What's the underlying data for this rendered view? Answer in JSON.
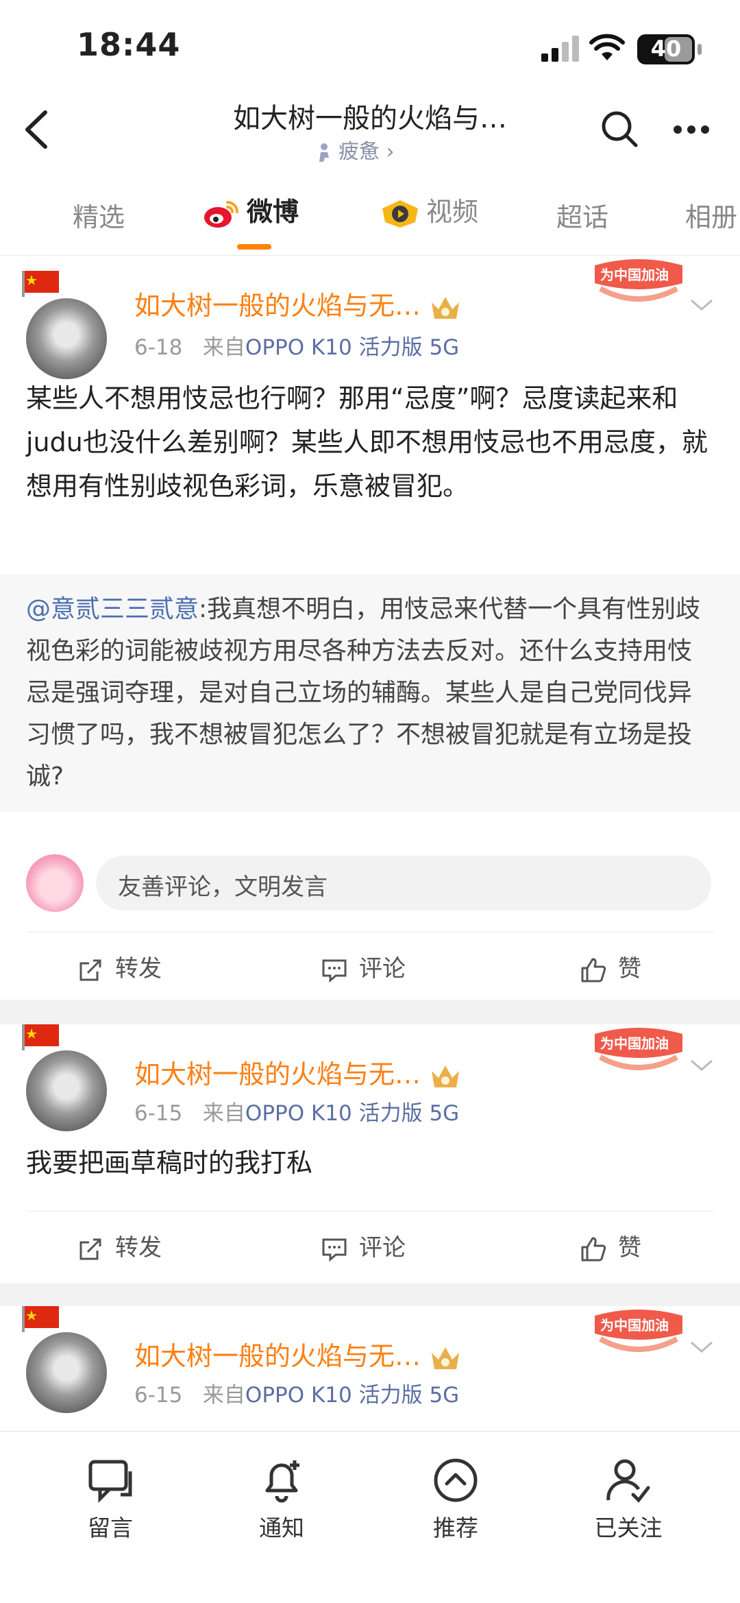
{
  "status_bar": {
    "time": "18:44",
    "battery": "40"
  },
  "header": {
    "title": "如大树一般的火焰与…",
    "subtitle": "疲惫",
    "subtitle_arrow": "›"
  },
  "tabs": [
    {
      "label": "精选"
    },
    {
      "label": "微博",
      "active": true
    },
    {
      "label": "视频"
    },
    {
      "label": "超话"
    },
    {
      "label": "相册"
    }
  ],
  "colors": {
    "accent": "#ff8200",
    "username": "#ff7f11",
    "link": "#4b6fb0"
  },
  "posts": [
    {
      "username": "如大树一般的火焰与无…",
      "badge": "为中国加油",
      "date": "6-18",
      "source_prefix": "来自",
      "source": "OPPO K10 活力版 5G",
      "text": "某些人不想用忮忌也行啊？那用“忌度”啊？忌度读起来和judu也没什么差别啊？某些人即不想用忮忌也不用忌度，就想用有性别歧视色彩词，乐意被冒犯。",
      "repost_at": "@意贰三三贰意",
      "repost_text": ":我真想不明白，用忮忌来代替一个具有性别歧视色彩的词能被歧视方用尽各种方法去反对。还什么支持用忮忌是强词夺理，是对自己立场的辅酶。某些人是自己党同伐异习惯了吗，我不想被冒犯怎么了？不想被冒犯就是有立场是投诚?",
      "comment_placeholder": "友善评论，文明发言",
      "actions": {
        "repost": "转发",
        "comment": "评论",
        "like": "赞"
      }
    },
    {
      "username": "如大树一般的火焰与无…",
      "badge": "为中国加油",
      "date": "6-15",
      "source_prefix": "来自",
      "source": "OPPO K10 活力版 5G",
      "text": "我要把画草稿时的我打私",
      "actions": {
        "repost": "转发",
        "comment": "评论",
        "like": "赞"
      }
    },
    {
      "username": "如大树一般的火焰与无…",
      "badge": "为中国加油",
      "date": "6-15",
      "source_prefix": "来自",
      "source": "OPPO K10 活力版 5G"
    }
  ],
  "bottom_nav": [
    {
      "label": "留言",
      "icon": "message-icon"
    },
    {
      "label": "通知",
      "icon": "bell-plus-icon"
    },
    {
      "label": "推荐",
      "icon": "chevron-up-circle-icon"
    },
    {
      "label": "已关注",
      "icon": "user-check-icon"
    }
  ]
}
